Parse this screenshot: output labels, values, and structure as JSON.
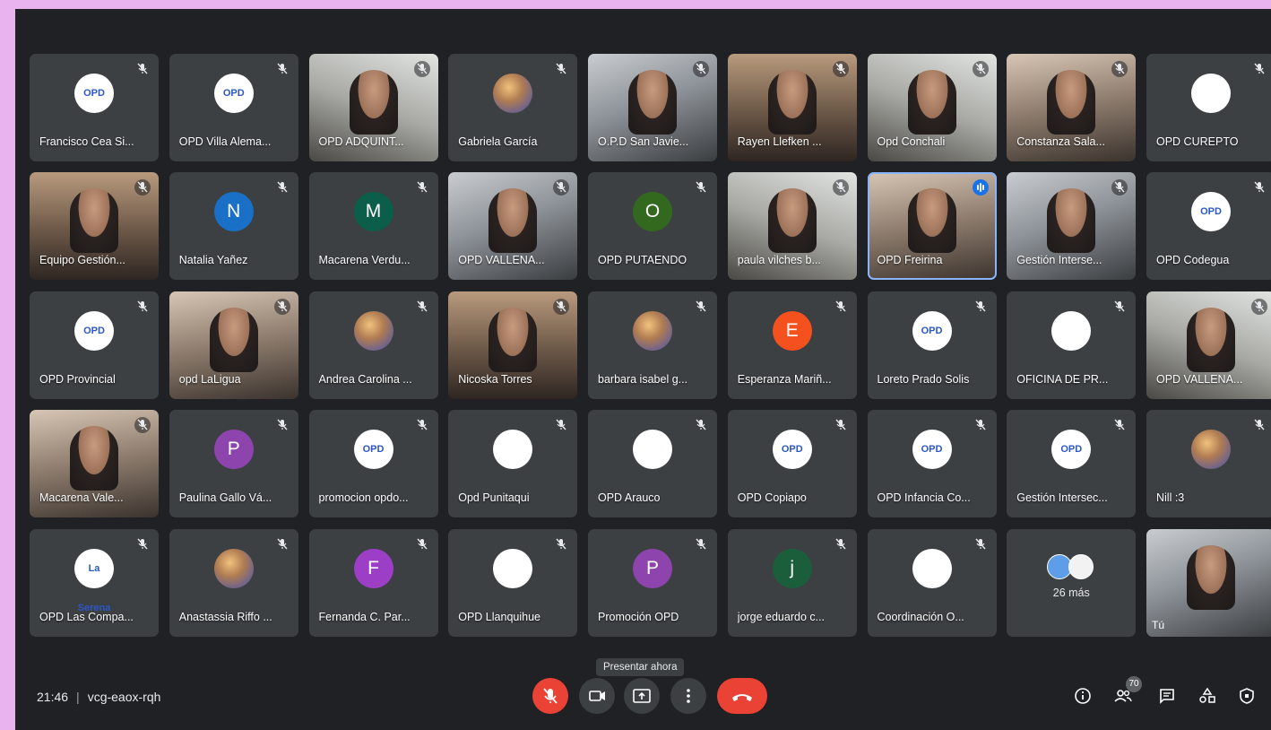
{
  "colors": {
    "page_background": "#e9b3ef",
    "meet_background": "#202124",
    "tile_background": "#3c4043",
    "end_call_red": "#ea4335",
    "speaking_highlight": "#8ab4f8"
  },
  "participants": [
    {
      "name": "Francisco Cea Si...",
      "avatar": "logo",
      "logo_text": "OPD"
    },
    {
      "name": "OPD Villa Alema...",
      "avatar": "logo",
      "logo_text": "OPD"
    },
    {
      "name": "OPD ADQUINT...",
      "avatar": "photo"
    },
    {
      "name": "Gabriela García",
      "avatar": "picture"
    },
    {
      "name": "O.P.D San Javie...",
      "avatar": "photo"
    },
    {
      "name": "Rayen Llefken ...",
      "avatar": "photo"
    },
    {
      "name": "Opd Conchali",
      "avatar": "photo"
    },
    {
      "name": "Constanza Sala...",
      "avatar": "photo"
    },
    {
      "name": "OPD CUREPTO",
      "avatar": "logo",
      "logo_text": ""
    },
    {
      "name": "Equipo Gestión...",
      "avatar": "photo"
    },
    {
      "name": "Natalia Yañez",
      "avatar": "letter",
      "letter": "N"
    },
    {
      "name": "Macarena Verdu...",
      "avatar": "letter",
      "letter": "M"
    },
    {
      "name": "OPD VALLENA...",
      "avatar": "photo"
    },
    {
      "name": "OPD PUTAENDO",
      "avatar": "letter",
      "letter": "O"
    },
    {
      "name": "paula vilches b...",
      "avatar": "photo"
    },
    {
      "name": "OPD Freirina",
      "avatar": "photo",
      "speaking": true
    },
    {
      "name": "Gestión Interse...",
      "avatar": "photo"
    },
    {
      "name": "OPD Codegua",
      "avatar": "logo",
      "logo_text": "OPD"
    },
    {
      "name": "OPD Provincial",
      "avatar": "logo",
      "logo_text": "OPD"
    },
    {
      "name": "opd LaLigua",
      "avatar": "photo"
    },
    {
      "name": "Andrea Carolina ...",
      "avatar": "picture"
    },
    {
      "name": "Nicoska Torres",
      "avatar": "photo"
    },
    {
      "name": "barbara isabel g...",
      "avatar": "picture"
    },
    {
      "name": "Esperanza Mariñ...",
      "avatar": "letter",
      "letter": "E"
    },
    {
      "name": "Loreto Prado Solis",
      "avatar": "logo",
      "logo_text": "OPD"
    },
    {
      "name": "OFICINA DE PR...",
      "avatar": "logo",
      "logo_text": ""
    },
    {
      "name": "OPD VALLENA...",
      "avatar": "photo"
    },
    {
      "name": "Macarena Vale...",
      "avatar": "photo"
    },
    {
      "name": "Paulina Gallo Vá...",
      "avatar": "letter",
      "letter": "P"
    },
    {
      "name": "promocion opdo...",
      "avatar": "logo",
      "logo_text": "OPD"
    },
    {
      "name": "Opd Punitaqui",
      "avatar": "logo",
      "logo_text": ""
    },
    {
      "name": "OPD Arauco",
      "avatar": "logo",
      "logo_text": ""
    },
    {
      "name": "OPD Copiapo",
      "avatar": "logo",
      "logo_text": "OPD"
    },
    {
      "name": "OPD Infancia Co...",
      "avatar": "logo",
      "logo_text": "OPD"
    },
    {
      "name": "Gestión Intersec...",
      "avatar": "logo",
      "logo_text": "OPD"
    },
    {
      "name": "Nill :3",
      "avatar": "picture"
    },
    {
      "name": "OPD Las Compa...",
      "avatar": "logo",
      "logo_text": "La Serena"
    },
    {
      "name": "Anastassia Riffo ...",
      "avatar": "picture"
    },
    {
      "name": "Fernanda C. Par...",
      "avatar": "letter",
      "letter": "F"
    },
    {
      "name": "OPD Llanquihue",
      "avatar": "logo",
      "logo_text": ""
    },
    {
      "name": "Promoción OPD",
      "avatar": "letter",
      "letter": "P"
    },
    {
      "name": "jorge eduardo c...",
      "avatar": "letter",
      "letter": "j"
    },
    {
      "name": "Coordinación O...",
      "avatar": "logo",
      "logo_text": ""
    },
    {
      "name": "26 más",
      "avatar": "more"
    },
    {
      "name": "Tú",
      "avatar": "self"
    }
  ],
  "footer": {
    "time": "21:46",
    "meeting_code": "vcg-eaox-rqh",
    "tooltip": "Presentar ahora",
    "participant_count": "70"
  },
  "icons": {
    "mic_muted": "mic-off-icon",
    "camera": "videocam-icon",
    "present": "present-screen-icon",
    "more": "more-vert-icon",
    "hangup": "call-end-icon",
    "info": "info-icon",
    "people": "people-icon",
    "chat": "chat-icon",
    "activities": "activities-icon",
    "host": "host-controls-icon"
  }
}
